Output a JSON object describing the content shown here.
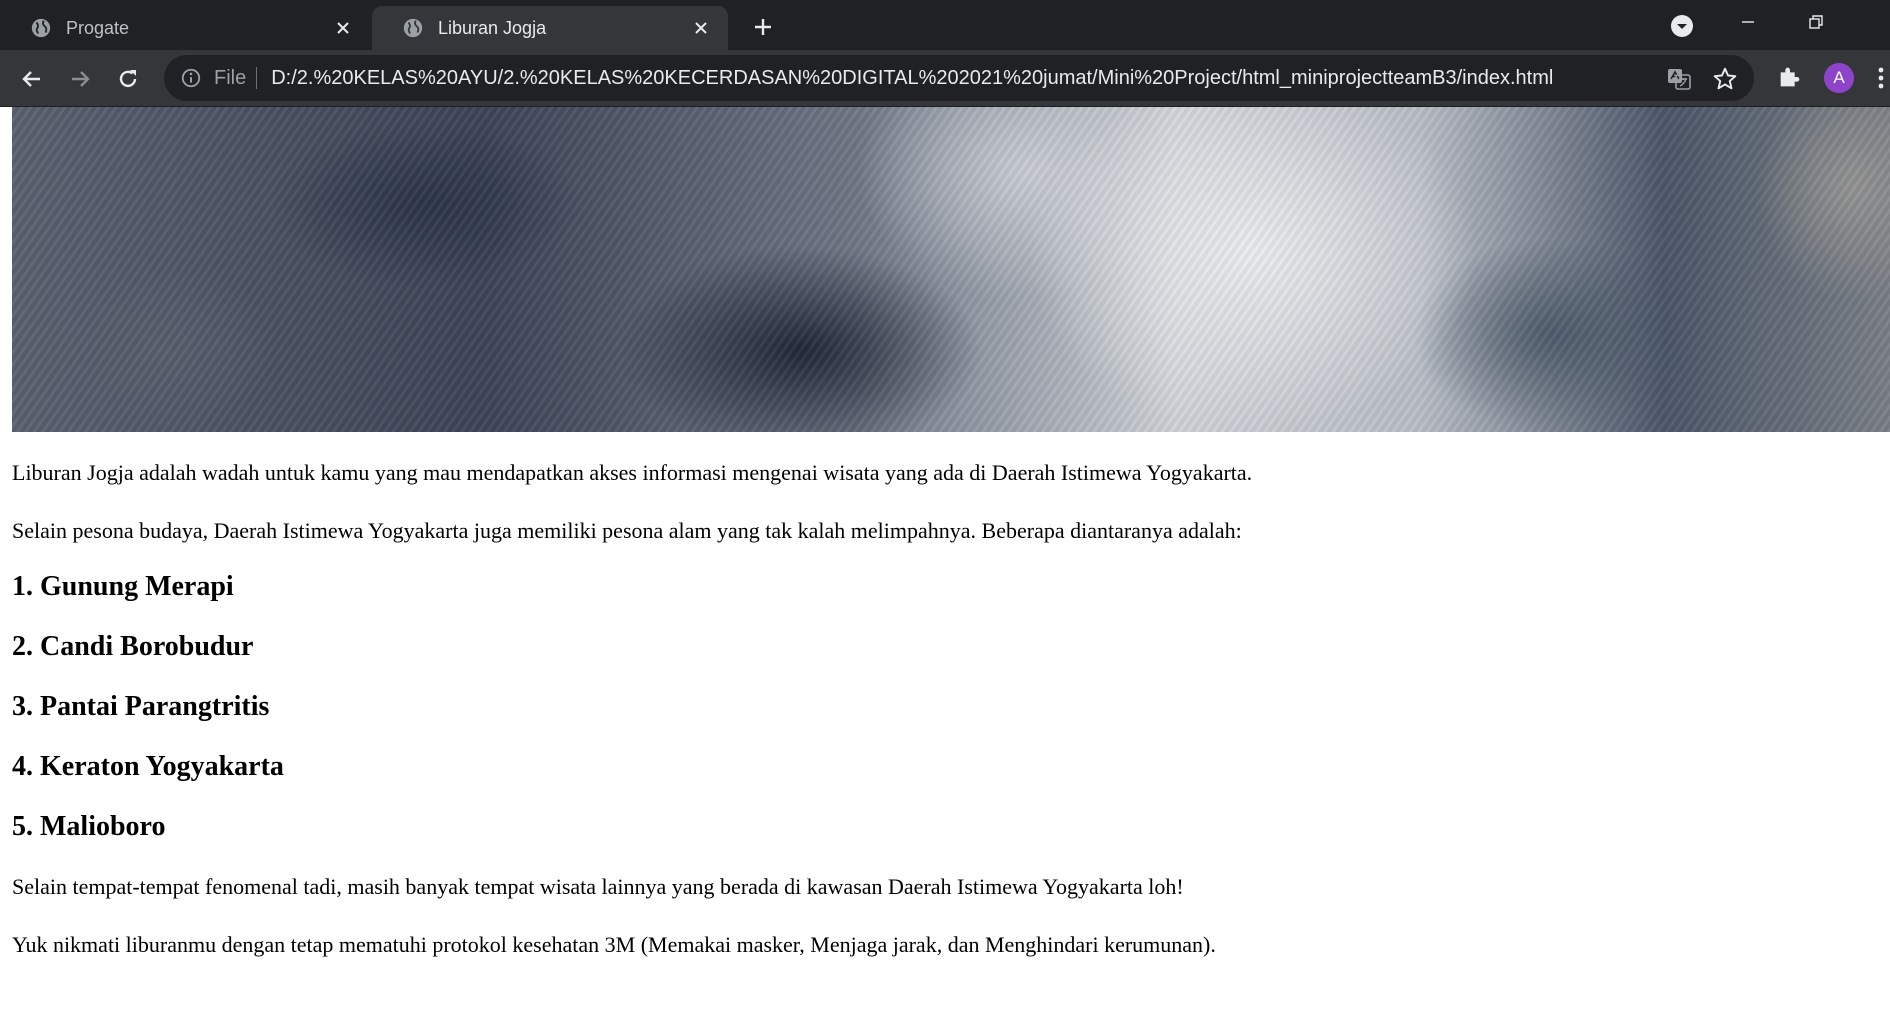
{
  "browser": {
    "tabs": [
      {
        "title": "Progate",
        "active": false,
        "icon": "globe-icon"
      },
      {
        "title": "Liburan Jogja",
        "active": true,
        "icon": "globe-icon"
      }
    ],
    "address_bar": {
      "scheme_label": "File",
      "url": "D:/2.%20KELAS%20AYU/2.%20KELAS%20KECERDASAN%20DIGITAL%202021%20jumat/Mini%20Project/html_miniprojectteamB3/index.html"
    },
    "profile_initial": "A",
    "colors": {
      "frame": "#202124",
      "toolbar": "#35363a",
      "avatar": "#8e44c9"
    }
  },
  "page": {
    "intro_1": "Liburan Jogja adalah wadah untuk kamu yang mau mendapatkan akses informasi mengenai wisata yang ada di Daerah Istimewa Yogyakarta.",
    "intro_2": "Selain pesona budaya, Daerah Istimewa Yogyakarta juga memiliki pesona alam yang tak kalah melimpahnya. Beberapa diantaranya adalah:",
    "places": [
      "1. Gunung Merapi",
      "2. Candi Borobudur",
      "3. Pantai Parangtritis",
      "4. Keraton Yogyakarta",
      "5. Malioboro"
    ],
    "outro_1": "Selain tempat-tempat fenomenal tadi, masih banyak tempat wisata lainnya yang berada di kawasan Daerah Istimewa Yogyakarta loh!",
    "outro_2": "Yuk nikmati liburanmu dengan tetap mematuhi protokol kesehatan 3M (Memakai masker, Menjaga jarak, dan Menghindari kerumunan)."
  }
}
